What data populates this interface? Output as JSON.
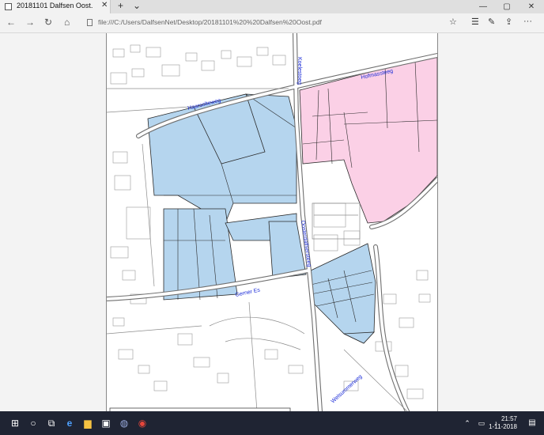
{
  "tab": {
    "title": "20181101 Dalfsen Oost.",
    "close": "✕",
    "new": "+",
    "menu": "⌄"
  },
  "window": {
    "minimize": "—",
    "maximize": "▢",
    "close": "✕"
  },
  "nav": {
    "back": "←",
    "forward": "→",
    "refresh": "↻",
    "home": "⌂",
    "url": "file:///C:/Users/DalfsenNet/Desktop/20181101%20%20Dalfsen%20Oost.pdf",
    "favorite": "☆",
    "hub": "☰",
    "notes": "✎",
    "share": "⇪",
    "more": "···"
  },
  "map": {
    "streets": {
      "top_vertical": "Koelestoeg",
      "hofmassteeg": "Hofmassteeg",
      "haarsolteweg": "Haarsolteweg",
      "oosterdalfserweg": "Oosterdalfsersteeg",
      "gerner_es": "Gerner Es",
      "welsummerweg": "Welsummerweg"
    },
    "colors": {
      "blue": "#b5d5ee",
      "pink": "#fbd0e6",
      "road": "#777777",
      "outline": "#1e1e1e"
    }
  },
  "taskbar": {
    "icons": [
      "windows-start-icon",
      "search-icon",
      "task-view-icon",
      "edge-icon",
      "file-explorer-icon",
      "store-icon",
      "app-icon",
      "chrome-icon"
    ],
    "time": "21:57",
    "date": "1-11-2018"
  }
}
